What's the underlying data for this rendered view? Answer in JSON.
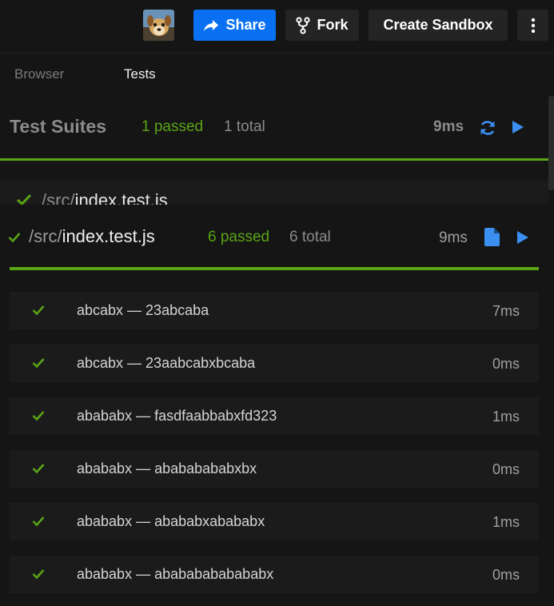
{
  "header": {
    "share_label": "Share",
    "fork_label": "Fork",
    "sandbox_label": "Create Sandbox",
    "share_icon": "share-arrow-icon",
    "fork_icon": "fork-icon",
    "more_icon": "vertical-dots-icon"
  },
  "tabs": [
    {
      "label": "Browser",
      "active": false
    },
    {
      "label": "Tests",
      "active": true
    }
  ],
  "suites": {
    "title": "Test Suites",
    "passed": "1 passed",
    "total": "1 total",
    "time": "9ms"
  },
  "background_file": {
    "dir": "/src/",
    "name": "index.test.js"
  },
  "file": {
    "dir": "/src/",
    "name": "index.test.js",
    "passed": "6 passed",
    "total": "6 total",
    "time": "9ms"
  },
  "tests": [
    {
      "name": "abcabx — 23abcaba",
      "time": "7ms"
    },
    {
      "name": "abcabx — 23aabcabxbcaba",
      "time": "0ms"
    },
    {
      "name": "abababx — fasdfaabbabxfd323",
      "time": "1ms"
    },
    {
      "name": "abababx — abababababxbx",
      "time": "0ms"
    },
    {
      "name": "abababx — abababxabababx",
      "time": "1ms"
    },
    {
      "name": "abababx — abababababababx",
      "time": "0ms"
    }
  ],
  "colors": {
    "accent_blue": "#0971f1",
    "pass_green": "#5aa416",
    "icon_blue": "#3b8ff0"
  }
}
